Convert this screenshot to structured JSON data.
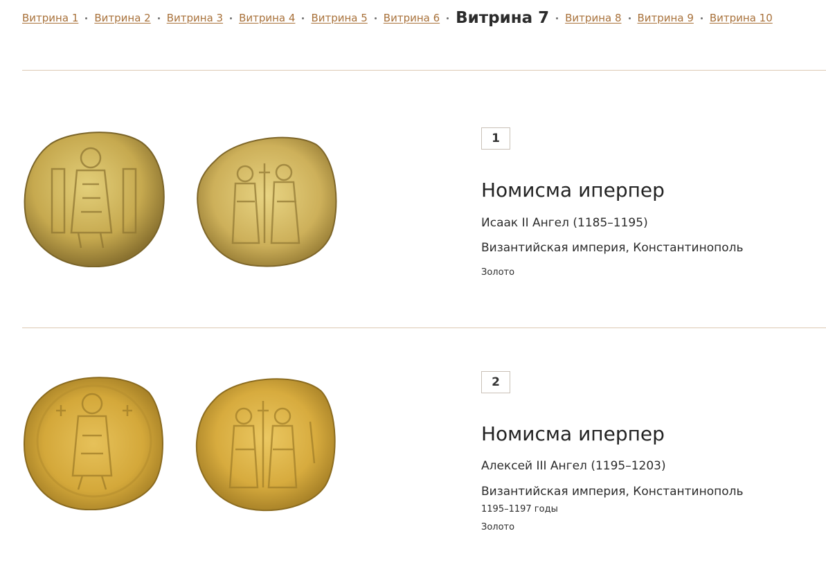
{
  "nav": {
    "items": [
      {
        "label": "Витрина 1"
      },
      {
        "label": "Витрина 2"
      },
      {
        "label": "Витрина 3"
      },
      {
        "label": "Витрина 4"
      },
      {
        "label": "Витрина 5"
      },
      {
        "label": "Витрина 6"
      },
      {
        "label": "Витрина 7"
      },
      {
        "label": "Витрина 8"
      },
      {
        "label": "Витрина 9"
      },
      {
        "label": "Витрина 10"
      }
    ],
    "current_index": 6
  },
  "colors": {
    "link": "#a8713a",
    "divider": "#ddc9b3",
    "text": "#2b2b2b",
    "gold_light": "#e6c86a",
    "gold_dark": "#a9872e"
  },
  "items": [
    {
      "number": "1",
      "title": "Номисма иперпер",
      "ruler": "Исаак II Ангел (1185–1195)",
      "place": "Византийская империя, Константинополь",
      "dates": "",
      "material": "Золото",
      "images": [
        "coin-obverse-image",
        "coin-reverse-image"
      ]
    },
    {
      "number": "2",
      "title": "Номисма иперпер",
      "ruler": "Алексей III Ангел (1195–1203)",
      "place": "Византийская империя, Константинополь",
      "dates": "1195–1197 годы",
      "material": "Золото",
      "images": [
        "coin-obverse-image",
        "coin-reverse-image"
      ]
    }
  ]
}
